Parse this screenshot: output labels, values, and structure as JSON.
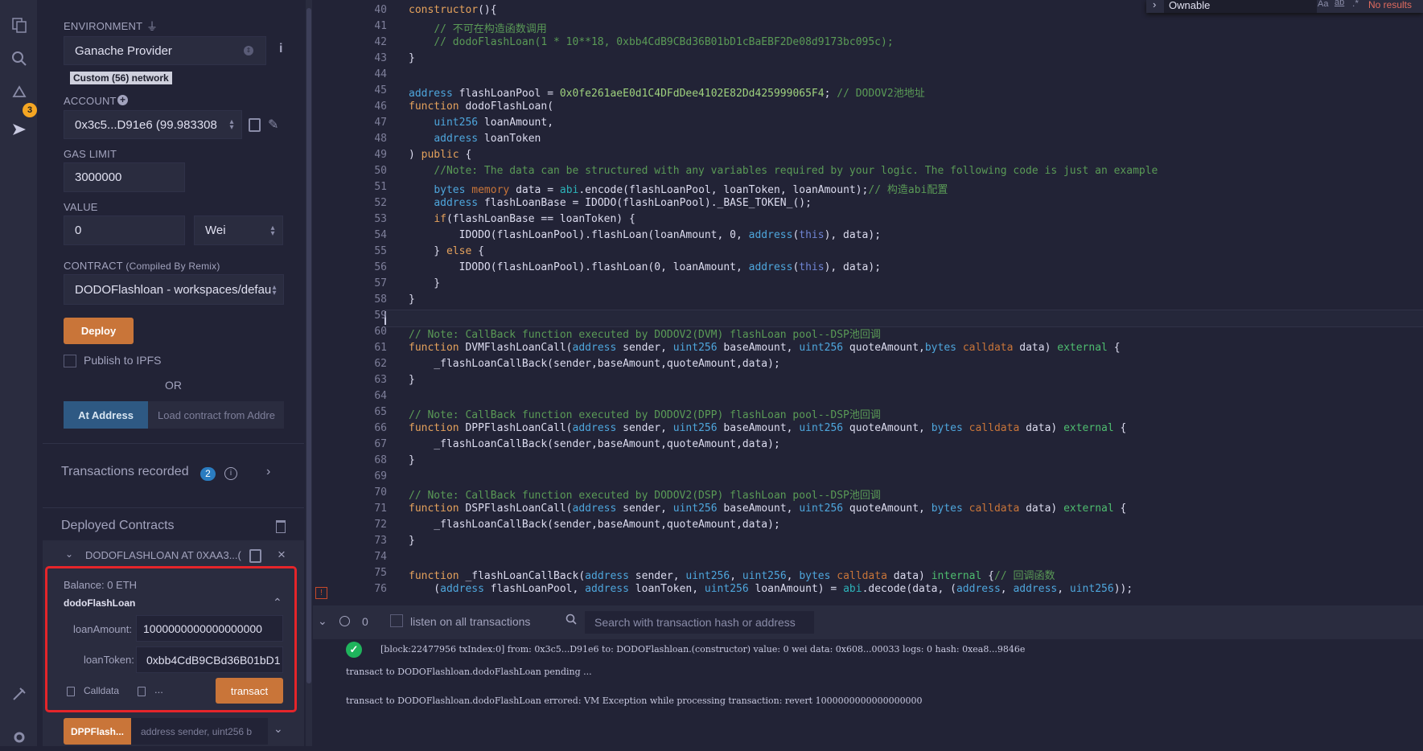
{
  "sidebar": {
    "environment_label": "ENVIRONMENT",
    "environment_value": "Ganache Provider",
    "network_badge": "Custom (56) network",
    "account_label": "ACCOUNT",
    "account_value": "0x3c5...D91e6 (99.983308",
    "gas_limit_label": "GAS LIMIT",
    "gas_limit_value": "3000000",
    "value_label": "VALUE",
    "value_amount": "0",
    "value_unit": "Wei",
    "contract_label": "CONTRACT",
    "contract_sublabel": "(Compiled By Remix)",
    "contract_value": "DODOFlashloan - workspaces/defaul",
    "deploy_button": "Deploy",
    "publish_ipfs": "Publish to IPFS",
    "or_text": "OR",
    "at_address_button": "At Address",
    "load_contract_placeholder": "Load contract from Addre",
    "transactions_recorded": "Transactions recorded",
    "transactions_count": "2",
    "deployed_contracts": "Deployed Contracts",
    "instance_name": "DODOFLASHLOAN AT 0XAA3...(",
    "balance": "Balance: 0 ETH",
    "function_name": "dodoFlashLoan",
    "param1_label": "loanAmount:",
    "param1_value": "1000000000000000000",
    "param2_label": "loanToken:",
    "param2_value": "0xbb4CdB9CBd36B01bD1",
    "calldata_label": "Calldata",
    "ellipsis": "...",
    "transact_button": "transact",
    "next_fn_button": "DPPFlash...",
    "next_fn_placeholder": "address sender, uint256 b"
  },
  "find_widget": {
    "query": "Ownable",
    "opt_case": "Aa",
    "opt_word": "ab",
    "opt_regex": ".*",
    "result": "No results"
  },
  "editor": {
    "lines": [
      {
        "n": "40",
        "text": "constructor(){"
      },
      {
        "n": "41",
        "text": "    // 不可在构造函数调用"
      },
      {
        "n": "42",
        "text": "    // dodoFlashLoan(1 * 10**18, 0xbb4CdB9CBd36B01bD1cBaEBF2De08d9173bc095c);"
      },
      {
        "n": "43",
        "text": "}"
      },
      {
        "n": "44",
        "text": ""
      },
      {
        "n": "45",
        "text": "address flashLoanPool = 0x0fe261aeE0d1C4DFdDee4102E82Dd425999065F4; // DODOV2池地址"
      },
      {
        "n": "46",
        "text": "function dodoFlashLoan("
      },
      {
        "n": "47",
        "text": "    uint256 loanAmount,"
      },
      {
        "n": "48",
        "text": "    address loanToken"
      },
      {
        "n": "49",
        "text": ") public {"
      },
      {
        "n": "50",
        "text": "    //Note: The data can be structured with any variables required by your logic. The following code is just an example"
      },
      {
        "n": "51",
        "text": "    bytes memory data = abi.encode(flashLoanPool, loanToken, loanAmount);// 构造abi配置"
      },
      {
        "n": "52",
        "text": "    address flashLoanBase = IDODO(flashLoanPool)._BASE_TOKEN_();"
      },
      {
        "n": "53",
        "text": "    if(flashLoanBase == loanToken) {"
      },
      {
        "n": "54",
        "text": "        IDODO(flashLoanPool).flashLoan(loanAmount, 0, address(this), data);"
      },
      {
        "n": "55",
        "text": "    } else {"
      },
      {
        "n": "56",
        "text": "        IDODO(flashLoanPool).flashLoan(0, loanAmount, address(this), data);"
      },
      {
        "n": "57",
        "text": "    }"
      },
      {
        "n": "58",
        "text": "}"
      },
      {
        "n": "59",
        "text": ""
      },
      {
        "n": "60",
        "text": "// Note: CallBack function executed by DODOV2(DVM) flashLoan pool--DSP池回调"
      },
      {
        "n": "61",
        "text": "function DVMFlashLoanCall(address sender, uint256 baseAmount, uint256 quoteAmount,bytes calldata data) external {"
      },
      {
        "n": "62",
        "text": "    _flashLoanCallBack(sender,baseAmount,quoteAmount,data);"
      },
      {
        "n": "63",
        "text": "}"
      },
      {
        "n": "64",
        "text": ""
      },
      {
        "n": "65",
        "text": "// Note: CallBack function executed by DODOV2(DPP) flashLoan pool--DSP池回调"
      },
      {
        "n": "66",
        "text": "function DPPFlashLoanCall(address sender, uint256 baseAmount, uint256 quoteAmount, bytes calldata data) external {"
      },
      {
        "n": "67",
        "text": "    _flashLoanCallBack(sender,baseAmount,quoteAmount,data);"
      },
      {
        "n": "68",
        "text": "}"
      },
      {
        "n": "69",
        "text": ""
      },
      {
        "n": "70",
        "text": "// Note: CallBack function executed by DODOV2(DSP) flashLoan pool--DSP池回调"
      },
      {
        "n": "71",
        "text": "function DSPFlashLoanCall(address sender, uint256 baseAmount, uint256 quoteAmount, bytes calldata data) external {"
      },
      {
        "n": "72",
        "text": "    _flashLoanCallBack(sender,baseAmount,quoteAmount,data);"
      },
      {
        "n": "73",
        "text": "}"
      },
      {
        "n": "74",
        "text": ""
      },
      {
        "n": "75",
        "text": "function _flashLoanCallBack(address sender, uint256, uint256, bytes calldata data) internal {// 回调函数"
      },
      {
        "n": "76",
        "text": "    (address flashLoanPool, address loanToken, uint256 loanAmount) = abi.decode(data, (address, address, uint256));"
      }
    ]
  },
  "terminal": {
    "count": "0",
    "listen_label": "listen on all transactions",
    "search_placeholder": "Search with transaction hash or address",
    "log1": "[block:22477956 txIndex:0]  from: 0x3c5...D91e6 to: DODOFlashloan.(constructor) value: 0 wei data: 0x608...00033 logs: 0 hash: 0xea8...9846e",
    "log2": "transact to DODOFlashloan.dodoFlashLoan pending ...",
    "log3": "transact to DODOFlashloan.dodoFlashLoan errored: VM Exception while processing transaction: revert 1000000000000000000"
  },
  "colors": {
    "accent": "#c97539",
    "highlight_box": "#e5252a",
    "background": "#222336",
    "panel": "#2a2c3f",
    "success": "#1fb45c",
    "badge": "#2a7cc0"
  },
  "icons": [
    "file-explorer-icon",
    "search-icon",
    "compiler-icon",
    "deploy-run-icon",
    "plugin-manager-icon",
    "settings-icon",
    "plug-icon",
    "info-icon",
    "plus-icon",
    "copy-icon",
    "edit-icon",
    "trash-icon",
    "close-icon",
    "chevron-down-icon",
    "chevron-up-icon",
    "chevron-right-icon",
    "check-circle-icon",
    "clear-icon",
    "search-icon"
  ]
}
